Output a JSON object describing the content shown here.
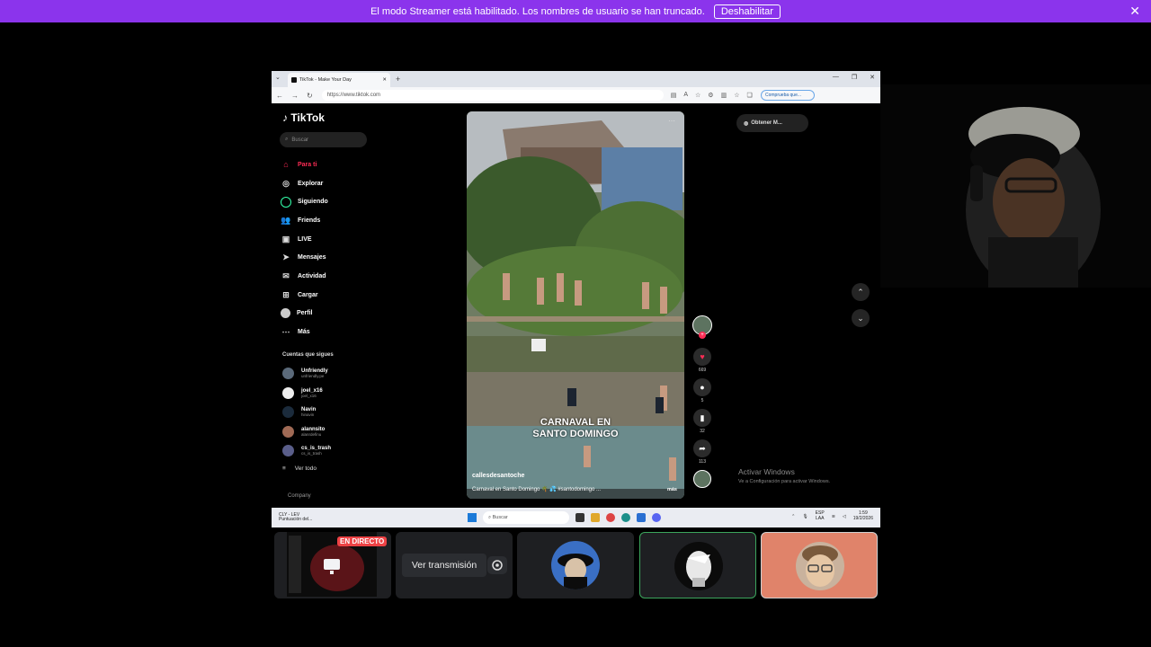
{
  "banner": {
    "message": "El modo Streamer está habilitado. Los nombres de usuario se han truncado.",
    "button": "Deshabilitar",
    "close": "✕"
  },
  "browser": {
    "tab_title": "TikTok - Make Your Day",
    "new_tab": "+",
    "url": "https://www.tiktok.com",
    "pill": "Comprueba que..."
  },
  "tiktok": {
    "logo": "TikTok",
    "search_placeholder": "Buscar",
    "nav": [
      {
        "label": "Para ti",
        "icon": "home-icon"
      },
      {
        "label": "Explorar",
        "icon": "compass-icon"
      },
      {
        "label": "Siguiendo",
        "icon": "following-icon"
      },
      {
        "label": "Friends",
        "icon": "friends-icon"
      },
      {
        "label": "LIVE",
        "icon": "live-icon"
      },
      {
        "label": "Mensajes",
        "icon": "messages-icon"
      },
      {
        "label": "Actividad",
        "icon": "activity-icon"
      },
      {
        "label": "Cargar",
        "icon": "upload-icon"
      },
      {
        "label": "Perfil",
        "icon": "profile-icon"
      },
      {
        "label": "Más",
        "icon": "more-icon"
      }
    ],
    "following_title": "Cuentas que sigues",
    "following": [
      {
        "name": "Unfriendly",
        "handle": "unfriendly.pe"
      },
      {
        "name": "joel_x16",
        "handle": "joel_x16"
      },
      {
        "name": "Navin",
        "handle": "hinavin"
      },
      {
        "name": "alannsito",
        "handle": "alanrdefinu"
      },
      {
        "name": "cs_is_trash",
        "handle": "cs_is_trash"
      }
    ],
    "see_all": "Ver todo",
    "company": "Company",
    "get_app": "Obtener M...",
    "video": {
      "caption_line1": "CARNAVAL EN",
      "caption_line2": "SANTO DOMINGO",
      "username": "callesdesantoche",
      "description": "Carnaval en Santo Domingo 🌴 💦 #santodomingo ...",
      "more": "más"
    },
    "counts": {
      "likes": "669",
      "comments": "5",
      "saves": "32",
      "shares": "113"
    },
    "activate_title": "Activar Windows",
    "activate_sub": "Ve a Configuración para activar Windows."
  },
  "taskbar": {
    "weather_line1": "CLY - LEV",
    "weather_line2": "Puntuación del...",
    "search": "Buscar",
    "lang1": "ESP",
    "lang2": "LAA",
    "time": "1:59",
    "date": "19/2/2026"
  },
  "participants": {
    "live_badge": "EN DIRECTO",
    "watch_button": "Ver transmisión"
  },
  "colors": {
    "banner": "#8b34ec",
    "tiktok_red": "#fe2c55",
    "speaking_border": "#3ba55c",
    "tile_bg": "#1e1f22",
    "highlight_tile": "#e0836a"
  }
}
